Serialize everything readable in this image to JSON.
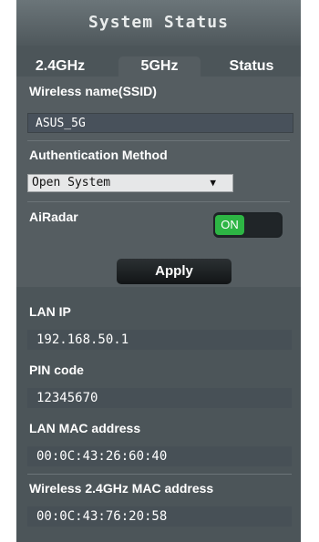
{
  "title": "System Status",
  "tabs": [
    {
      "label": "2.4GHz"
    },
    {
      "label": "5GHz",
      "selected": true
    },
    {
      "label": "Status"
    }
  ],
  "wireless": {
    "ssid_label": "Wireless name(SSID)",
    "ssid_value": "ASUS_5G",
    "auth_label": "Authentication Method",
    "auth_value": "Open System",
    "airadar_label": "AiRadar",
    "airadar_state": "ON",
    "apply_label": "Apply"
  },
  "info": {
    "lan_ip_label": "LAN IP",
    "lan_ip_value": "192.168.50.1",
    "pin_label": "PIN code",
    "pin_value": "12345670",
    "lan_mac_label": "LAN MAC address",
    "lan_mac_value": "00:0C:43:26:60:40",
    "wifi_mac_label": "Wireless 2.4GHz MAC address",
    "wifi_mac_value": "00:0C:43:76:20:58"
  },
  "colors": {
    "panel_bg": "#4c5559",
    "section_bg": "#555d61",
    "toggle_on": "#2db544",
    "button_bg": "#1a1e20"
  },
  "icons": {
    "dropdown": "chevron-down-icon"
  }
}
